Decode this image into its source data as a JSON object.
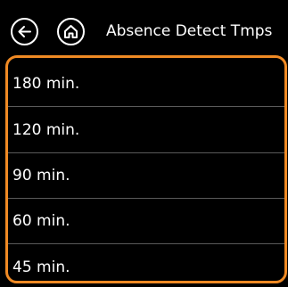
{
  "header": {
    "title": "Absence Detect Tmps",
    "back_icon": "arrow-left-icon",
    "home_icon": "home-icon"
  },
  "colors": {
    "background": "#000000",
    "text": "#ffffff",
    "accent_frame": "#f08a24",
    "divider": "#5a5a5a"
  },
  "options": [
    {
      "label": "180 min."
    },
    {
      "label": "120 min."
    },
    {
      "label": "90 min."
    },
    {
      "label": "60 min."
    },
    {
      "label": "45 min."
    }
  ]
}
